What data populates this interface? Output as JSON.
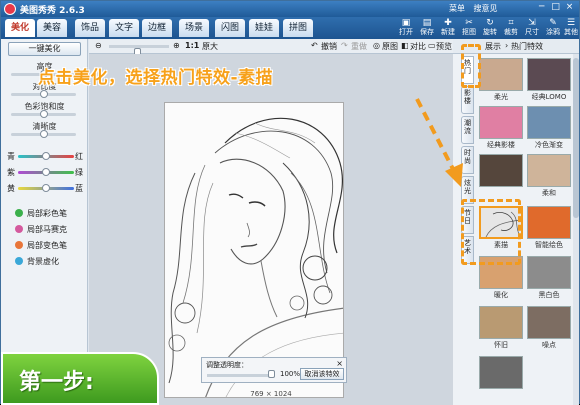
{
  "titlebar": {
    "title": "美图秀秀 2.6.3",
    "links": [
      "菜单",
      "搜意见"
    ],
    "controls": [
      "─",
      "□",
      "×"
    ]
  },
  "tabs": [
    {
      "label": "美化",
      "active": true
    },
    {
      "label": "美容",
      "active": false
    },
    {
      "label": "饰品",
      "active": false
    },
    {
      "label": "文字",
      "active": false
    },
    {
      "label": "边框",
      "active": false
    },
    {
      "label": "场景",
      "active": false
    },
    {
      "label": "闪图",
      "active": false
    },
    {
      "label": "娃娃",
      "active": false
    },
    {
      "label": "拼图",
      "active": false
    }
  ],
  "top_tools": [
    {
      "label": "打开",
      "icon": "folder-icon",
      "glyph": "▣"
    },
    {
      "label": "保存",
      "icon": "save-icon",
      "glyph": "▤"
    },
    {
      "label": "新建",
      "icon": "new-icon",
      "glyph": "✚"
    },
    {
      "label": "抠图",
      "icon": "cutout-icon",
      "glyph": "✂"
    },
    {
      "label": "旋转",
      "icon": "rotate-icon",
      "glyph": "↻"
    },
    {
      "label": "裁剪",
      "icon": "crop-icon",
      "glyph": "⌗"
    },
    {
      "label": "尺寸",
      "icon": "resize-icon",
      "glyph": "⇲"
    },
    {
      "label": "涂鸦",
      "icon": "brush-icon",
      "glyph": "✎"
    },
    {
      "label": "其他",
      "icon": "more-icon",
      "glyph": "☰"
    }
  ],
  "left_panel": {
    "one_click_label": "一键美化",
    "adjust_labels": [
      "高度",
      "对比度",
      "色彩饱和度",
      "清晰度"
    ],
    "adjust_values": [
      0.5,
      0.5,
      0.5,
      0.5
    ],
    "color_rows": [
      {
        "left": "青",
        "right": "红",
        "gradient": "linear-gradient(90deg,#27c3c9,#e84141)"
      },
      {
        "left": "紫",
        "right": "绿",
        "gradient": "linear-gradient(90deg,#b04ad4,#3fc24a)"
      },
      {
        "left": "黄",
        "right": "蓝",
        "gradient": "linear-gradient(90deg,#e9d93c,#3e6fe0)"
      }
    ],
    "tools": [
      {
        "label": "局部彩色笔",
        "color": "#3bb04c"
      },
      {
        "label": "局部马赛克",
        "color": "#d45a9e"
      },
      {
        "label": "局部变色笔",
        "color": "#e8763a"
      },
      {
        "label": "背景虚化",
        "color": "#3aa8d8"
      }
    ]
  },
  "canvas_toolbar": {
    "zoom_ratio": "1:1",
    "zoom_extra": "原大",
    "undo": "撤销",
    "redo": "重做",
    "original": "原图",
    "compare": "对比",
    "preview": "预览"
  },
  "canvas": {
    "size_readout": "769 × 1024"
  },
  "opacity_dialog": {
    "title": "调整透明度：",
    "close": "×",
    "value": "100%",
    "value_fraction": 1.0,
    "cancel_label": "取消该特效"
  },
  "right_panel": {
    "header_label": "热门特效",
    "header_prefix": "展示",
    "categories": [
      {
        "label": "热门",
        "active": true
      },
      {
        "label": "影楼"
      },
      {
        "label": "潮流"
      },
      {
        "label": "时尚"
      },
      {
        "label": "炫光"
      },
      {
        "label": "节日"
      },
      {
        "label": "艺术"
      }
    ],
    "effects": [
      {
        "name": "柔光",
        "tint": "#c9a98f"
      },
      {
        "name": "经典LOMO",
        "tint": "#5b4a52"
      },
      {
        "name": "经典影楼",
        "tint": "#e07fa3"
      },
      {
        "name": "冷色渐变",
        "tint": "#6d8fb0"
      },
      {
        "name": "",
        "tint": "#55463c"
      },
      {
        "name": "柔和",
        "tint": "#cfb49a"
      },
      {
        "name": "素描",
        "tint": "#e6e6e6",
        "selected": true
      },
      {
        "name": "智能绘色",
        "tint": "#e06a2c"
      },
      {
        "name": "暖化",
        "tint": "#d8a16f"
      },
      {
        "name": "黑白色",
        "tint": "#8c8c8c"
      },
      {
        "name": "怀旧",
        "tint": "#b99a72"
      },
      {
        "name": "噪点",
        "tint": "#7d6d62"
      },
      {
        "name": "",
        "tint": "#6a6a6a"
      }
    ]
  },
  "overlay": {
    "callout": "点击美化，选择热门特效-素描",
    "step": "第一步:"
  },
  "colors": {
    "accent_orange": "#f29b1e",
    "step_green": "#5bb52f",
    "title_blue": "#2a6aab"
  }
}
